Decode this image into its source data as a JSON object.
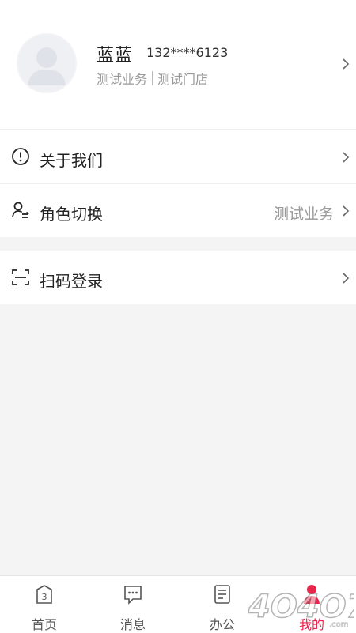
{
  "profile": {
    "name": "蓝蓝",
    "phone": "132****6123",
    "business": "测试业务",
    "store": "测试门店"
  },
  "menu": {
    "about": {
      "label": "关于我们",
      "icon": "info-icon"
    },
    "role": {
      "label": "角色切换",
      "value": "测试业务",
      "icon": "user-switch-icon"
    },
    "scan": {
      "label": "扫码登录",
      "icon": "scan-icon"
    }
  },
  "tabbar": {
    "home": {
      "label": "首页",
      "icon": "home-icon"
    },
    "messages": {
      "label": "消息",
      "icon": "message-icon"
    },
    "office": {
      "label": "办公",
      "icon": "office-icon"
    },
    "mine": {
      "label": "我的",
      "icon": "user-icon",
      "active": true
    }
  },
  "colors": {
    "accent": "#e8254a",
    "muted": "#999999",
    "background": "#f4f4f4"
  },
  "watermark": "4O4O7.com"
}
